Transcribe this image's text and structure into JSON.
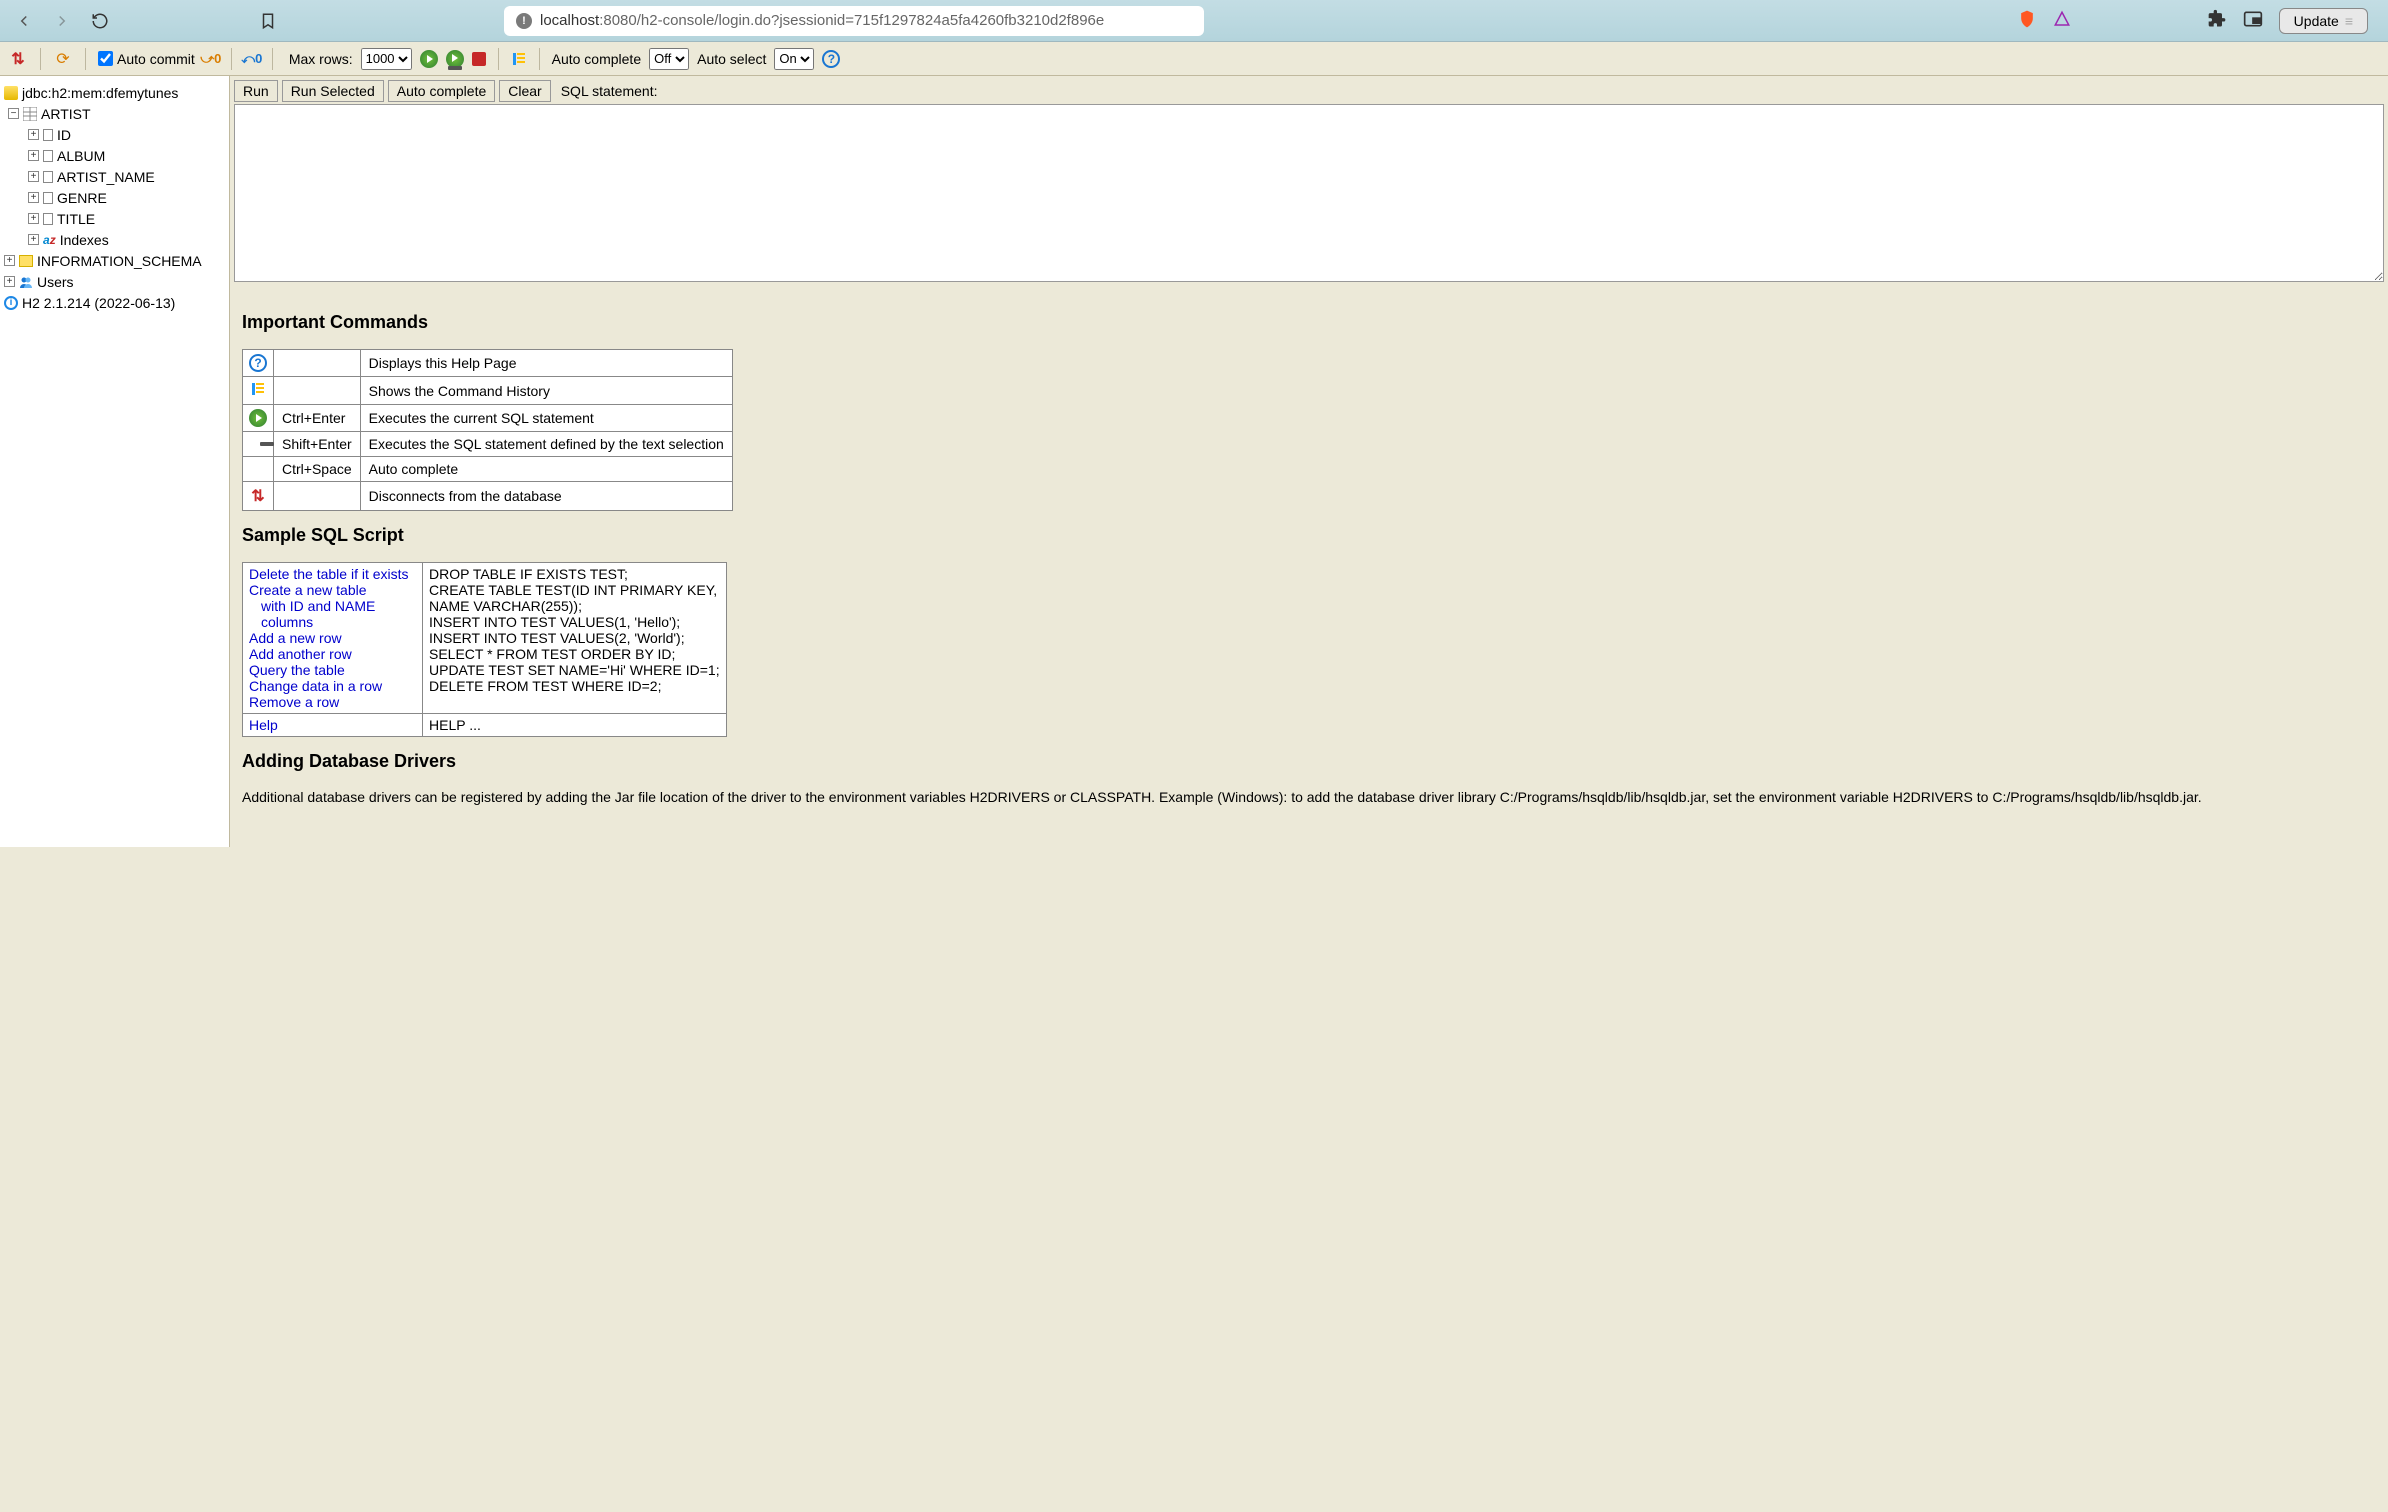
{
  "browser": {
    "url_prefix": "localhost",
    "url_rest": ":8080/h2-console/login.do?jsessionid=715f1297824a5fa4260fb3210d2f896e",
    "update_label": "Update"
  },
  "toolbar": {
    "auto_commit_label": "Auto commit",
    "max_rows_label": "Max rows:",
    "max_rows_value": "1000",
    "auto_complete_label": "Auto complete",
    "auto_complete_value": "Off",
    "auto_select_label": "Auto select",
    "auto_select_value": "On"
  },
  "sidebar": {
    "db_label": "jdbc:h2:mem:dfemytunes",
    "table_name": "ARTIST",
    "columns": [
      "ID",
      "ALBUM",
      "ARTIST_NAME",
      "GENRE",
      "TITLE"
    ],
    "indexes_label": "Indexes",
    "info_schema": "INFORMATION_SCHEMA",
    "users_label": "Users",
    "version": "H2 2.1.214 (2022-06-13)"
  },
  "runbar": {
    "run": "Run",
    "run_selected": "Run Selected",
    "auto_complete": "Auto complete",
    "clear": "Clear",
    "sql_label": "SQL statement:"
  },
  "headings": {
    "important": "Important Commands",
    "sample": "Sample SQL Script",
    "drivers": "Adding Database Drivers"
  },
  "commands": [
    {
      "icon": "help",
      "key": "",
      "desc": "Displays this Help Page"
    },
    {
      "icon": "history",
      "key": "",
      "desc": "Shows the Command History"
    },
    {
      "icon": "run",
      "key": "Ctrl+Enter",
      "desc": "Executes the current SQL statement"
    },
    {
      "icon": "runsel",
      "key": "Shift+Enter",
      "desc": "Executes the SQL statement defined by the text selection"
    },
    {
      "icon": "",
      "key": "Ctrl+Space",
      "desc": "Auto complete"
    },
    {
      "icon": "disconnect",
      "key": "",
      "desc": "Disconnects from the database"
    }
  ],
  "samples": [
    {
      "left": "Delete the table if it exists",
      "sub": "",
      "right": "DROP TABLE IF EXISTS TEST;"
    },
    {
      "left": "Create a new table",
      "sub": "with ID and NAME columns",
      "right": "CREATE TABLE TEST(ID INT PRIMARY KEY,\n   NAME VARCHAR(255));"
    },
    {
      "left": "Add a new row",
      "sub": "",
      "right": "INSERT INTO TEST VALUES(1, 'Hello');"
    },
    {
      "left": "Add another row",
      "sub": "",
      "right": "INSERT INTO TEST VALUES(2, 'World');"
    },
    {
      "left": "Query the table",
      "sub": "",
      "right": "SELECT * FROM TEST ORDER BY ID;"
    },
    {
      "left": "Change data in a row",
      "sub": "",
      "right": "UPDATE TEST SET NAME='Hi' WHERE ID=1;"
    },
    {
      "left": "Remove a row",
      "sub": "",
      "right": "DELETE FROM TEST WHERE ID=2;"
    }
  ],
  "sample_help": {
    "left": "Help",
    "right": "HELP ..."
  },
  "drivers_text": "Additional database drivers can be registered by adding the Jar file location of the driver to the environment variables H2DRIVERS or CLASSPATH. Example (Windows): to add the database driver library C:/Programs/hsqldb/lib/hsqldb.jar, set the environment variable H2DRIVERS to C:/Programs/hsqldb/lib/hsqldb.jar."
}
